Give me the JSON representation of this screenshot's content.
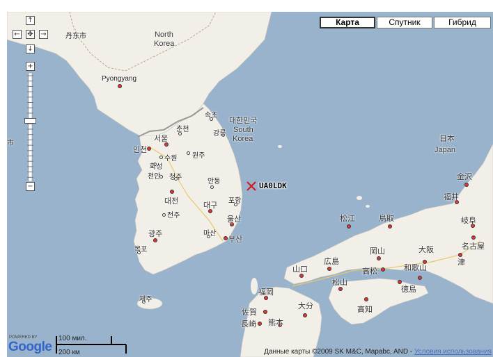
{
  "map_types": {
    "map": "Карта",
    "satellite": "Спутник",
    "hybrid": "Гибрид",
    "active": "map"
  },
  "controls": {
    "pan_up": "↑",
    "pan_down": "↓",
    "pan_left": "←",
    "pan_right": "→",
    "pan_center": "✥",
    "zoom_in": "+",
    "zoom_out": "−",
    "zoom_level_fraction": 0.44
  },
  "marker": {
    "label": "UA0LDK"
  },
  "labels": {
    "north_korea_1": "North",
    "north_korea_2": "Korea",
    "pyongyang": "Pyongyang",
    "south_korea_native": "대한민국",
    "south_korea_1": "South",
    "south_korea_2": "Korea",
    "japan_native": "日本",
    "japan": "Japan",
    "dandong": "丹东市",
    "china_edge": "市",
    "sokcho": "속초",
    "chuncheon": "춘천",
    "gangneung": "강릉",
    "seoul": "서울",
    "incheon": "인천",
    "suwon": "수원",
    "wonju": "원주",
    "hwaseong": "화성",
    "cheongju": "청주",
    "cheonan": "천안",
    "andong": "안동",
    "daejeon": "대전",
    "jeonju": "전주",
    "daegu": "대구",
    "pohang": "포항",
    "ulsan": "울산",
    "masan": "마산",
    "busan": "부산",
    "gwangju": "광주",
    "mokpo": "목포",
    "jeju": "제주",
    "kanazawa": "金沢",
    "fukui": "福井",
    "gifu": "岐阜",
    "nagoya": "名古屋",
    "tsu": "津",
    "matsue": "松江",
    "tottori": "鳥取",
    "okayama": "岡山",
    "osaka": "大阪",
    "wakayama": "和歌山",
    "tokushima": "徳島",
    "takamatsu": "高松",
    "kochi": "高知",
    "yamaguchi": "山口",
    "hiroshima": "広島",
    "matsuyama": "松山",
    "fukuoka": "福岡",
    "saga": "佐賀",
    "nagasaki": "長崎",
    "kumamoto": "熊本",
    "oita": "大分"
  },
  "scale": {
    "miles": "100 мил.",
    "km": "200 км"
  },
  "logo": {
    "powered_by": "POWERED BY",
    "google": "Google"
  },
  "copyright": {
    "text": "Данные карты ©2009 SK M&C, Mapabc, AND - ",
    "link": "Условия использования"
  },
  "colors": {
    "water": "#99b3cc",
    "land": "#f2efe9",
    "border": "#9a9a9a",
    "marker": "#d01818",
    "city": "#e03535"
  }
}
